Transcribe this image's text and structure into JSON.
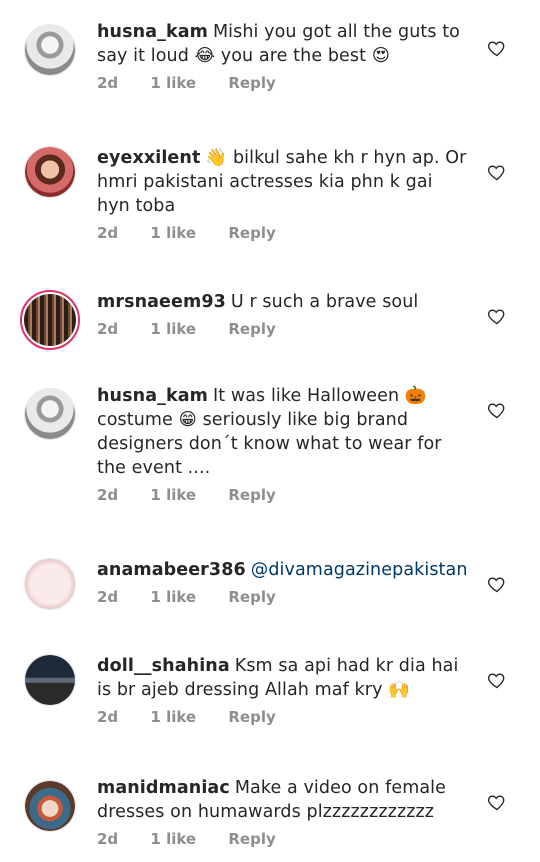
{
  "comments": [
    {
      "username": "husna_kam",
      "text": "Mishi you got all the guts to say it loud 😂 you  are the best 😍",
      "age": "2d",
      "likes": "1 like",
      "reply": "Reply",
      "avatar_color": "#d8d8d8",
      "avatar_icon": "woman-portrait"
    },
    {
      "username": "eyexxilent",
      "text": "👋 bilkul sahe kh r hyn ap. Or hmri pakistani actresses kia phn k gai hyn  toba",
      "age": "2d",
      "likes": "1 like",
      "reply": "Reply",
      "avatar_color": "#c87a5a",
      "avatar_icon": "woman-portrait"
    },
    {
      "username": "mrsnaeem93",
      "text": "U r such  a brave soul",
      "age": "2d",
      "likes": "1 like",
      "reply": "Reply",
      "avatar_color": "#3a2a22",
      "avatar_icon": "embroidered-dress"
    },
    {
      "username": "husna_kam",
      "text": "It was like Halloween 🎃 costume 😁 seriously like  big brand designers don´t know what to wear for the event ....",
      "age": "2d",
      "likes": "1 like",
      "reply": "Reply",
      "avatar_color": "#d8d8d8",
      "avatar_icon": "woman-portrait"
    },
    {
      "username": "anamabeer386",
      "mention": "@divamagazinepakistan",
      "text": "",
      "age": "2d",
      "likes": "1 like",
      "reply": "Reply",
      "avatar_color": "#f2dada",
      "avatar_icon": "text-graphic"
    },
    {
      "username": "doll__shahina",
      "text": "Ksm sa api had kr dia hai is br ajeb dressing Allah maf kry 🙌",
      "age": "2d",
      "likes": "1 like",
      "reply": "Reply",
      "avatar_color": "#2a3b4a",
      "avatar_icon": "dark-landscape"
    },
    {
      "username": "manidmaniac",
      "text": "Make a video on female dresses on humawards plzzzzzzzzzzzz",
      "age": "2d",
      "likes": "1 like",
      "reply": "Reply",
      "avatar_color": "#7b4a3a",
      "avatar_icon": "mad-hatter"
    }
  ],
  "colors": {
    "text": "#262626",
    "meta": "#8e8e8e",
    "mention": "#00376b",
    "heart_stroke": "#262626"
  },
  "icons": {
    "like": "heart-outline-icon"
  }
}
